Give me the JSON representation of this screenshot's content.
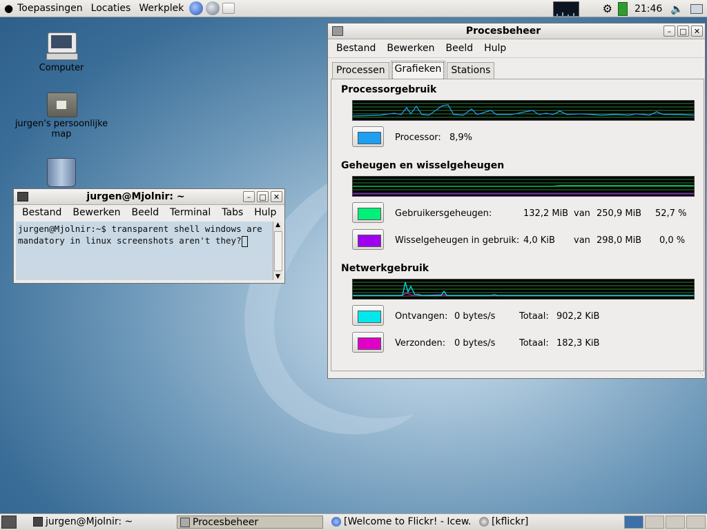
{
  "top_panel": {
    "menus": [
      "Toepassingen",
      "Locaties",
      "Werkplek"
    ],
    "clock": "21:46"
  },
  "desktop": {
    "icons": [
      "Computer",
      "jurgen's persoonlijke map"
    ]
  },
  "procman": {
    "title": "Procesbeheer",
    "menu": [
      "Bestand",
      "Bewerken",
      "Beeld",
      "Hulp"
    ],
    "tabs": [
      "Processen",
      "Grafieken",
      "Stations"
    ],
    "active_tab": "Grafieken",
    "cpu": {
      "section": "Processorgebruik",
      "label": "Processor:",
      "value": "8,9%",
      "color": "#1e9ff2"
    },
    "mem": {
      "section": "Geheugen en wisselgeheugen",
      "user_label": "Gebruikersgeheugen:",
      "user_used": "132,2 MiB",
      "user_van": "van",
      "user_total": "250,9 MiB",
      "user_pct": "52,7 %",
      "user_color": "#00f07a",
      "swap_label": "Wisselgeheugen in gebruik:",
      "swap_used": "4,0 KiB",
      "swap_van": "van",
      "swap_total": "298,0 MiB",
      "swap_pct": "0,0 %",
      "swap_color": "#a000f0"
    },
    "net": {
      "section": "Netwerkgebruik",
      "recv_label": "Ontvangen:",
      "recv_rate": "0 bytes/s",
      "recv_total_label": "Totaal:",
      "recv_total": "902,2 KiB",
      "recv_color": "#00e8ee",
      "sent_label": "Verzonden:",
      "sent_rate": "0 bytes/s",
      "sent_total_label": "Totaal:",
      "sent_total": "182,3 KiB",
      "sent_color": "#e000c8"
    }
  },
  "terminal": {
    "title": "jurgen@Mjolnir: ~",
    "menu": [
      "Bestand",
      "Bewerken",
      "Beeld",
      "Terminal",
      "Tabs",
      "Hulp"
    ],
    "text": "jurgen@Mjolnir:~$ transparent shell windows are mandatory in linux screenshots aren't they?"
  },
  "taskbar": {
    "items": [
      "jurgen@Mjolnir: ~",
      "Procesbeheer",
      "[Welcome to Flickr! - Icew...",
      "[kflickr]"
    ],
    "active": "Procesbeheer"
  }
}
